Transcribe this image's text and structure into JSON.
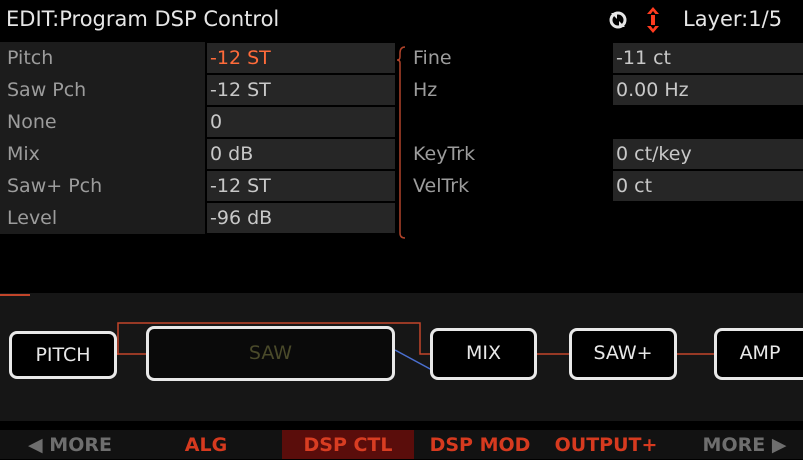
{
  "header": {
    "title": "EDIT:Program DSP Control",
    "layer": "Layer:1/5",
    "icons": [
      "sync-icon",
      "up-down-arrow-icon"
    ]
  },
  "left_params": [
    {
      "label": "Pitch",
      "value": "-12 ST",
      "highlight": true
    },
    {
      "label": "Saw Pch",
      "value": "-12 ST",
      "highlight": false
    },
    {
      "label": "None",
      "value": "0",
      "highlight": false
    },
    {
      "label": "Mix",
      "value": "0 dB",
      "highlight": false
    },
    {
      "label": "Saw+ Pch",
      "value": "-12 ST",
      "highlight": false
    },
    {
      "label": "Level",
      "value": "-96 dB",
      "highlight": false
    }
  ],
  "right_params": [
    {
      "label": "Fine",
      "value": "-11 ct"
    },
    {
      "label": "Hz",
      "value": "0.00 Hz"
    },
    {
      "label": "KeyTrk",
      "value": "0 ct/key"
    },
    {
      "label": "VelTrk",
      "value": "0 ct"
    }
  ],
  "algorithm": {
    "blocks": [
      "PITCH",
      "SAW",
      "MIX",
      "SAW+",
      "AMP"
    ]
  },
  "softkeys": {
    "more_left": "MORE",
    "alg": "ALG",
    "dsp_ctl": "DSP CTL",
    "dsp_mod": "DSP MOD",
    "output_plus": "OUTPUT+",
    "more_right": "MORE"
  },
  "colors": {
    "accent": "#ff6b3a",
    "selected_softkey_bg": "#5a0d0b",
    "softkey_text": "#d63a1f"
  }
}
